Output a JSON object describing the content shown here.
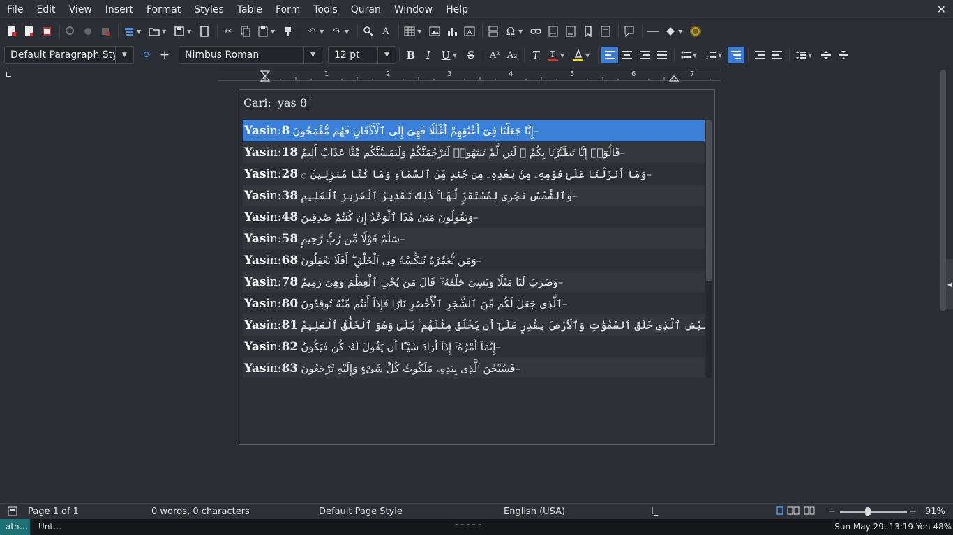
{
  "menu": [
    "File",
    "Edit",
    "View",
    "Insert",
    "Format",
    "Styles",
    "Table",
    "Form",
    "Tools",
    "Quran",
    "Window",
    "Help"
  ],
  "close_icon": "✕",
  "toolbar2": {
    "paragraph_style": "Default Paragraph Sty",
    "font_name": "Nimbus Roman",
    "font_size": "12 pt"
  },
  "ruler_numbers": [
    "1",
    "2",
    "3",
    "4",
    "5",
    "6",
    "7"
  ],
  "search": {
    "label": "Cari:",
    "value": "yas 8"
  },
  "results": [
    {
      "sura": "Yas",
      "rest": "in:",
      "ayah": "8",
      "arabic": "–إِنَّا جَعَلْنَا فِىٓ أَعْنَٰقِهِمْ أَغْلَٰلًا فَهِىَ إِلَى ٱلْأَذْقَانِ فَهُم مُّقْمَحُونَ"
    },
    {
      "sura": "Yas",
      "rest": "in:",
      "ayah": "18",
      "arabic": "–قَالُوٓا۟ إِنَّا تَطَيَّرْنَا بِكُمْ ۖ لَئِن لَّمْ تَنتَهُوا۟ لَنَرْجُمَنَّكُمْ وَلَيَمَسَّنَّكُم مِّنَّا عَذَابٌ أَلِيمٌ"
    },
    {
      "sura": "Yas",
      "rest": "in:",
      "ayah": "28",
      "arabic": "–وَمَآ أَنزَلْنَا عَلَىٰ قَوْمِهِۦ مِنۢ بَعْدِهِۦ مِن جُندٍ مِّنَ ٱلسَّمَآءِ وَمَا كُنَّا مُنزِلِينَ ۞"
    },
    {
      "sura": "Yas",
      "rest": "in:",
      "ayah": "38",
      "arabic": "–وَٱلشَّمْسُ تَجْرِى لِمُسْتَقَرٍّ لَّهَا ۚ ذَٰلِكَ تَقْدِيرُ ٱلْعَزِيزِ ٱلْعَلِيمِ"
    },
    {
      "sura": "Yas",
      "rest": "in:",
      "ayah": "48",
      "arabic": "–وَيَقُولُونَ مَتَىٰ هَٰذَا ٱلْوَعْدُ إِن كُنتُمْ صَٰدِقِينَ"
    },
    {
      "sura": "Yas",
      "rest": "in:",
      "ayah": "58",
      "arabic": "–سَلَٰمٌ قَوْلًا مِّن رَّبٍّ رَّحِيمٍ"
    },
    {
      "sura": "Yas",
      "rest": "in:",
      "ayah": "68",
      "arabic": "–وَمَن نُّعَمِّرْهُ نُنَكِّسْهُ فِى ٱلْخَلْقِ ۖ أَفَلَا يَعْقِلُونَ"
    },
    {
      "sura": "Yas",
      "rest": "in:",
      "ayah": "78",
      "arabic": "–وَضَرَبَ لَنَا مَثَلًا وَنَسِىَ خَلْقَهُۥ ۖ قَالَ مَن يُحْىِ ٱلْعِظَٰمَ وَهِىَ رَمِيمٌ"
    },
    {
      "sura": "Yas",
      "rest": "in:",
      "ayah": "80",
      "arabic": "–ٱلَّذِى جَعَلَ لَكُم مِّنَ ٱلشَّجَرِ ٱلْأَخْضَرِ نَارًا فَإِذَآ أَنتُم مِّنْهُ تُوقِدُونَ"
    },
    {
      "sura": "Yas",
      "rest": "in:",
      "ayah": "81",
      "arabic": "–أَوَلَيْسَ ٱلَّذِى خَلَقَ ٱلسَّمَٰوَٰتِ وَٱلْأَرْضَ بِقَٰدِرٍ عَلَىٰٓ أَن يَخْلُقَ مِثْلَهُم ۚ بَلَىٰ وَهُوَ ٱلْخَلَّٰقُ ٱلْعَلِيمُ"
    },
    {
      "sura": "Yas",
      "rest": "in:",
      "ayah": "82",
      "arabic": "–إِنَّمَآ أَمْرُهُۥٓ إِذَآ أَرَادَ شَيْـًٔا أَن يَقُولَ لَهُۥ كُن فَيَكُونُ"
    },
    {
      "sura": "Yas",
      "rest": "in:",
      "ayah": "83",
      "arabic": "–فَسُبْحَٰنَ ٱلَّذِى بِيَدِهِۦ مَلَكُوتُ كُلِّ شَىْءٍ وَإِلَيْهِ تُرْجَعُونَ"
    }
  ],
  "statusbar": {
    "page": "Page 1 of 1",
    "words": "0 words, 0 characters",
    "page_style": "Default Page Style",
    "language": "English (USA)",
    "zoom": "91%"
  },
  "taskbar": {
    "active": "ath…",
    "app": "Unt…",
    "clock": "Sun May 29, 13:19",
    "battery": "Yoh 48%"
  }
}
